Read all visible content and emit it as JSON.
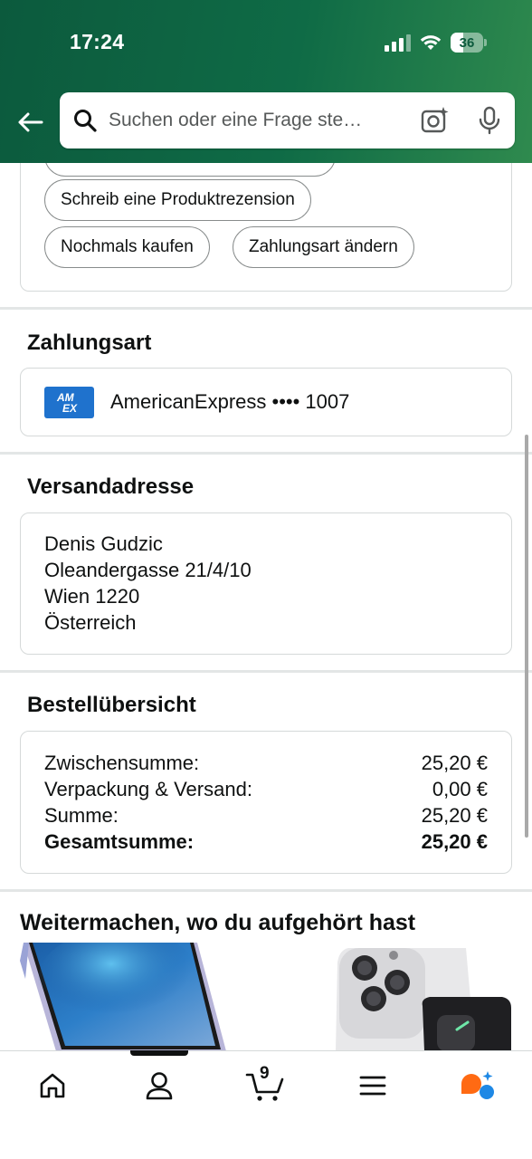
{
  "status_bar": {
    "time": "17:24",
    "battery_level": "36",
    "icons": [
      "cellular-signal-icon",
      "wifi-icon",
      "battery-icon"
    ]
  },
  "header": {
    "back_icon": "arrow-left-icon",
    "search_placeholder": "Suchen oder eine Frage ste…",
    "search_icon": "search-icon",
    "camera_icon": "camera-sparkle-icon",
    "mic_icon": "microphone-icon",
    "brand_color": "#0f6b46"
  },
  "actions": {
    "write_review": "Schreib eine Produktrezension",
    "buy_again": "Nochmals kaufen",
    "change_payment": "Zahlungsart ändern"
  },
  "payment": {
    "title": "Zahlungsart",
    "card_label": "AmericanExpress •••• 1007",
    "card_logo_text": "AM EX",
    "card_color": "#1f72cd"
  },
  "shipping": {
    "title": "Versandadresse",
    "lines": [
      "Denis Gudzic",
      "Oleandergasse 21/4/10",
      "Wien 1220",
      "Österreich"
    ]
  },
  "summary": {
    "title": "Bestellübersicht",
    "rows": [
      {
        "label": "Zwischensumme:",
        "value": "25,20 €"
      },
      {
        "label": "Verpackung & Versand:",
        "value": "0,00 €"
      },
      {
        "label": "Summe:",
        "value": "25,20 €"
      },
      {
        "label": "Gesamtsumme:",
        "value": "25,20 €"
      }
    ]
  },
  "continue": {
    "title": "Weitermachen, wo du aufgehört hast",
    "products": [
      "blue-smartphone-image",
      "magnetic-power-bank-image"
    ]
  },
  "bottom_nav": {
    "items": [
      "home-icon",
      "account-icon",
      "cart-icon",
      "menu-icon",
      "rufus-ai-icon"
    ],
    "cart_count": "9",
    "active_index": 1
  }
}
